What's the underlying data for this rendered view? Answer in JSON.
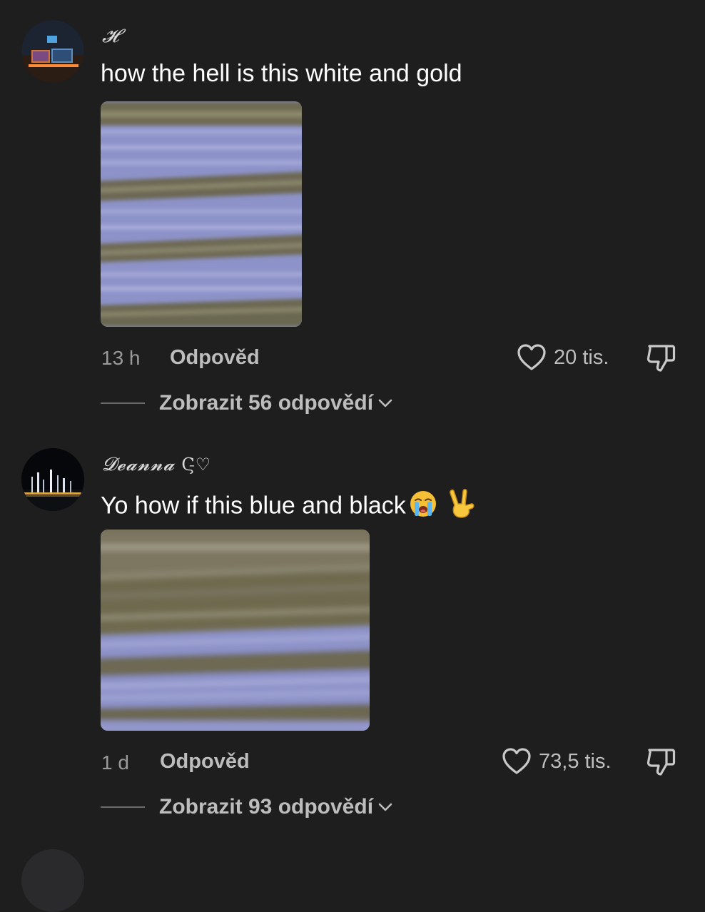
{
  "comments": [
    {
      "username": "𝓗",
      "text": "how the hell is this white and gold",
      "time": "13 h",
      "reply_label": "Odpověd",
      "likes": "20 tis.",
      "replies_label": "Zobrazit 56 odpovědí",
      "avatar_icon": "gaming-setup-avatar"
    },
    {
      "username": "𝓓𝓮𝓪𝓷𝓷𝓪",
      "username_suffix": "Ϛ̵♡",
      "text": "Yo how if this blue and black",
      "emojis": [
        "loudly-crying-face-icon",
        "victory-hand-icon"
      ],
      "time": "1 d",
      "reply_label": "Odpověd",
      "likes": "73,5 tis.",
      "replies_label": "Zobrazit 93 odpovědí",
      "avatar_icon": "night-fountain-avatar"
    }
  ],
  "colors": {
    "background": "#1e1e1f",
    "text": "#ffffff",
    "muted": "#9a9a9a",
    "dress_blue": "#8d93c9",
    "dress_gold": "#6e6a4e"
  }
}
